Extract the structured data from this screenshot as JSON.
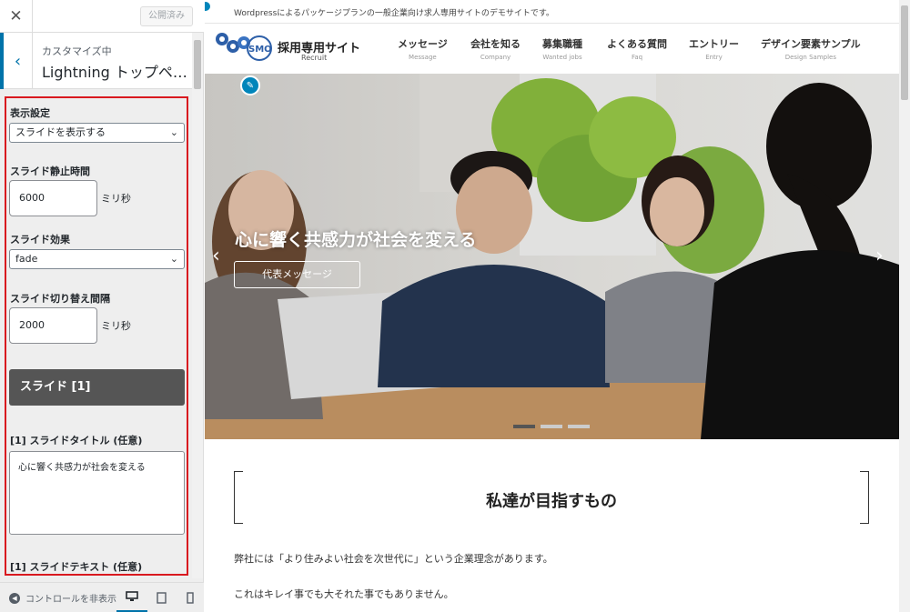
{
  "customizer": {
    "close_icon": "close-icon",
    "publish_label": "公開済み",
    "customizing_label": "カスタマイズ中",
    "section_title": "Lightning トップペ…",
    "controls": {
      "display_label": "表示設定",
      "display_value": "スライドを表示する",
      "interval_label": "スライド静止時間",
      "interval_value": "6000",
      "interval_unit": "ミリ秒",
      "effect_label": "スライド効果",
      "effect_value": "fade",
      "speed_label": "スライド切り替え間隔",
      "speed_value": "2000",
      "speed_unit": "ミリ秒",
      "slide_heading": "スライド [1]",
      "slide_title_label": "[1] スライドタイトル (任意)",
      "slide_title_value": "心に響く共感力が社会を変える",
      "slide_text_label": "[1] スライドテキスト (任意)"
    },
    "footer": {
      "hide_controls_label": "コントロールを非表示",
      "devices": [
        "desktop",
        "tablet",
        "mobile"
      ]
    },
    "accent_color": "#0073aa",
    "highlight_color": "#d9191f"
  },
  "preview": {
    "tagline": "Wordpressによるパッケージプランの一般企業向け求人専用サイトのデモサイトです。",
    "logo_title": "採用専用サイト",
    "logo_subtitle": "Recruit",
    "logo_text": "SMO",
    "nav": [
      {
        "jp": "メッセージ",
        "en": "Message"
      },
      {
        "jp": "会社を知る",
        "en": "Company"
      },
      {
        "jp": "募集職種",
        "en": "Wanted jobs"
      },
      {
        "jp": "よくある質問",
        "en": "Faq"
      },
      {
        "jp": "エントリー",
        "en": "Entry"
      },
      {
        "jp": "デザイン要素サンプル",
        "en": "Design Samples"
      }
    ],
    "hero": {
      "title": "心に響く共感力が社会を変える",
      "button": "代表メッセージ",
      "prev_icon": "chevron-left-icon",
      "next_icon": "chevron-right-icon",
      "pager_count": 3,
      "active_index": 0
    },
    "content": {
      "heading": "私達が目指すもの",
      "paragraphs": [
        "弊社には「より住みよい社会を次世代に」という企業理念があります。",
        "これはキレイ事でも大それた事でもありません。"
      ]
    }
  }
}
